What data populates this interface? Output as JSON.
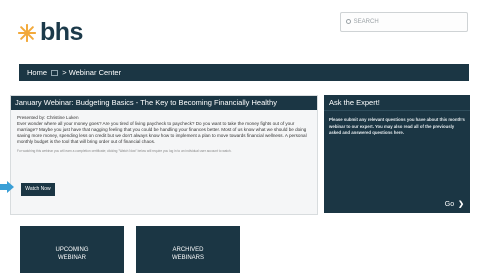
{
  "header": {
    "logo_text": "bhs",
    "search_placeholder": "SEARCH"
  },
  "nav": {
    "home": "Home",
    "separator": ">",
    "current": "Webinar Center"
  },
  "webinar": {
    "title": "January Webinar:  Budgeting Basics - The Key to Becoming Financially Healthy",
    "presenter": "Presented by:  Christine Luken",
    "description": "Ever wonder where all your money goes? Are you tired of living paycheck to paycheck? Do you want to take the money fights out of your marriage? Maybe you just have that nagging feeling that you could be handling your finances better. Most of us know what we should be doing saving more money, spending less on credit but we don't always know how to implement a plan to move towards financial wellness. A personal monthly budget is the tool that will bring order out of financial chaos.",
    "disclaimer": "For watching this webinar you will earn a completion certificate; clicking \"Watch Now\" below will require you log in to an individual user account to watch.",
    "watch_label": "Watch Now"
  },
  "expert": {
    "title": "Ask the Expert!",
    "description": "Please submit any relevant questions you have about this month's webinar to our expert. You may also read all of the previously asked and answered questions here.",
    "go_label": "Go"
  },
  "tiles": [
    {
      "line1": "UPCOMING",
      "line2": "WEBINAR",
      "line3": ""
    },
    {
      "line1": "ARCHIVED",
      "line2": "WEBINARS",
      "line3": ""
    }
  ],
  "colors": {
    "brand_dark": "#1b3644",
    "logo_star": "#f2a93b",
    "pointer": "#3a9fd6"
  },
  "icons": {
    "logo": "star-logo-icon",
    "search": "search-icon",
    "home": "home-icon",
    "go": "chevron-right-icon",
    "pointer": "arrow-pointer-icon"
  }
}
